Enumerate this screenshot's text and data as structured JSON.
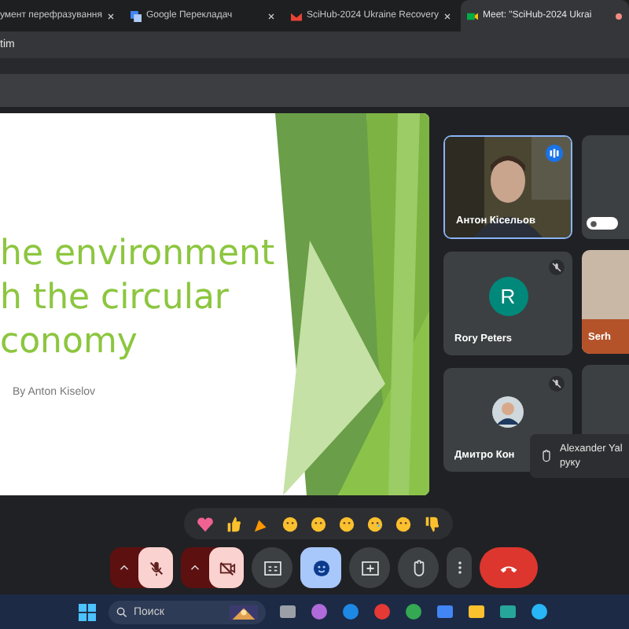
{
  "tabs": [
    {
      "title": "умент перефразування",
      "selected": false
    },
    {
      "title": "Google Перекладач",
      "selected": false
    },
    {
      "title": "SciHub-2024 Ukraine Recovery",
      "selected": false
    },
    {
      "title": "Meet: \"SciHub-2024 Ukrai",
      "selected": true
    }
  ],
  "address": {
    "value": "tim"
  },
  "slide": {
    "title_lines": [
      "he environment",
      "h the circular",
      "conomy"
    ],
    "author": "By Anton Kiselov"
  },
  "participants": [
    {
      "name": "Антон Кісельов",
      "kind": "video",
      "speaking": true,
      "muted": false
    },
    {
      "name": "Rory Peters",
      "kind": "letter",
      "initial": "R",
      "color": "#00897b",
      "speaking": false,
      "muted": true
    },
    {
      "name": "Дмитро Кон",
      "speaking": false,
      "muted": true
    }
  ],
  "side_tile": {
    "name": "Serh"
  },
  "toast": {
    "lines": [
      "Alexander Yal",
      "руку"
    ]
  },
  "controls": {
    "microphone_off": true,
    "camera_off": true,
    "reactions_open": true
  },
  "taskbar": {
    "search_placeholder": "Поиск"
  }
}
